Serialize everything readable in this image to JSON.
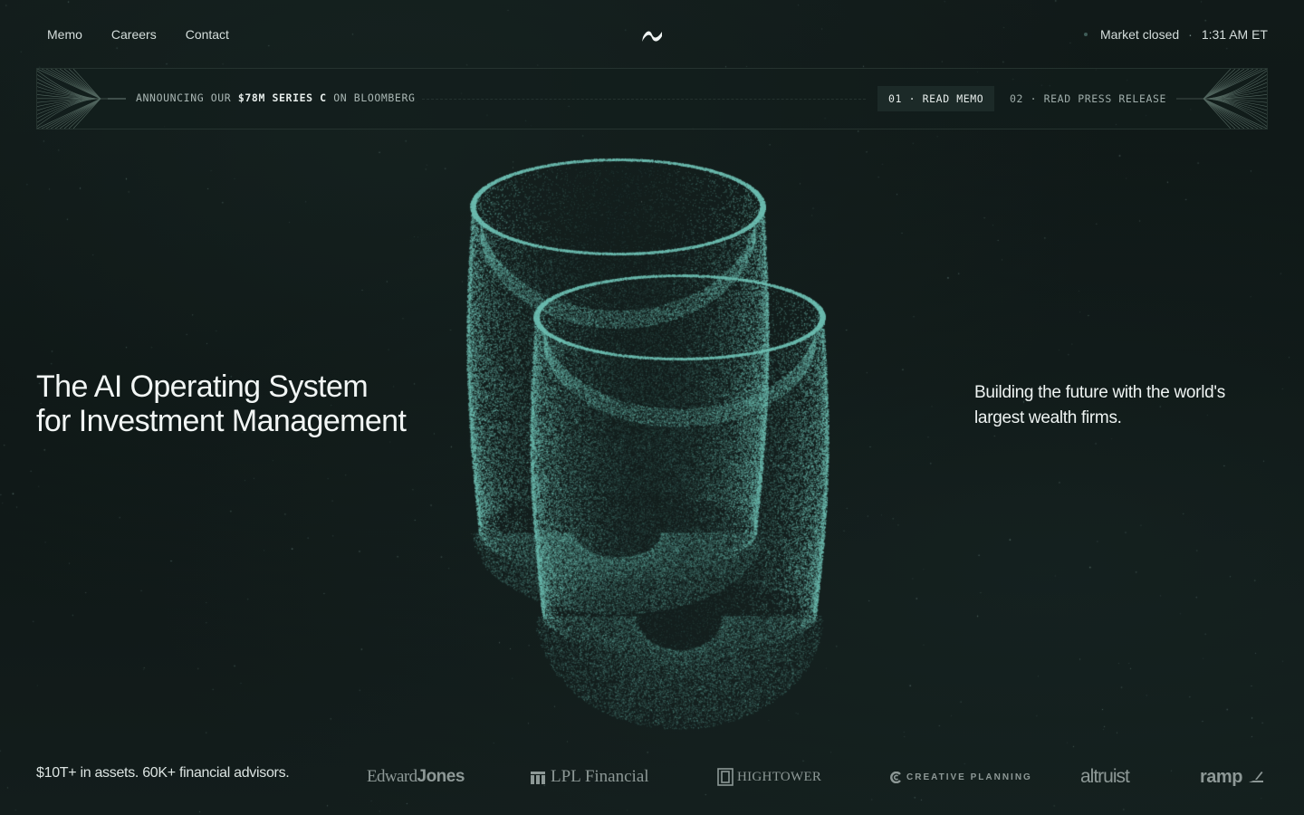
{
  "nav": {
    "links": [
      "Memo",
      "Careers",
      "Contact"
    ],
    "market_status": "Market closed",
    "separator": "·",
    "time": "1:31 AM ET"
  },
  "banner": {
    "prefix": "ANNOUNCING OUR",
    "highlight": "$78M SERIES C",
    "suffix": "ON BLOOMBERG",
    "memo_button": "01 · READ MEMO",
    "press_button": "02 · READ PRESS RELEASE"
  },
  "hero": {
    "headline_line1": "The AI Operating System",
    "headline_line2": "for Investment Management",
    "subheadline": "Building the future with the world's largest wealth firms."
  },
  "footer": {
    "stats": "$10T+ in assets. 60K+ financial advisors.",
    "logos": {
      "edward_jones_a": "Edward",
      "edward_jones_b": "Jones",
      "lpl": "LPL Financial",
      "hightower": "HIGHTOWER",
      "creative_planning": "CREATIVE PLANNING",
      "altruist": "altruist",
      "ramp": "ramp"
    }
  },
  "colors": {
    "background": "#0f1716",
    "particle": "#6fb8ad",
    "banner_border": "#25332f",
    "muted_logo": "#8d9896"
  },
  "icons": [
    "logo-mark-icon",
    "status-dot-icon",
    "lpl-mark-icon",
    "hightower-mark-icon",
    "creative-planning-mark-icon",
    "ramp-mark-icon"
  ]
}
